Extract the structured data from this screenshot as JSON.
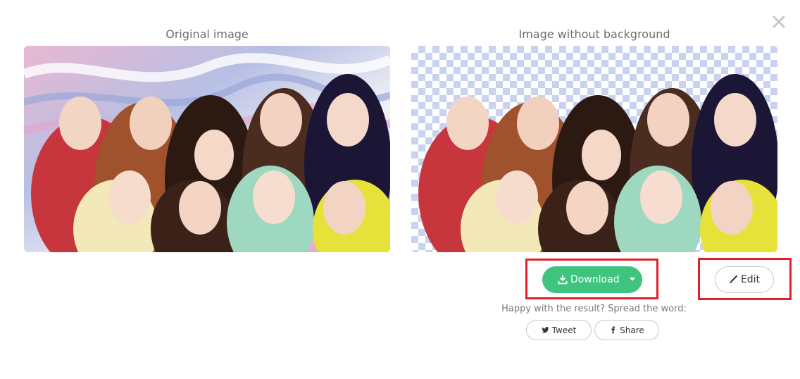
{
  "panels": {
    "original_title": "Original image",
    "result_title": "Image without background"
  },
  "actions": {
    "download_label": "Download",
    "edit_label": "Edit"
  },
  "share": {
    "prompt": "Happy with the result? Spread the word:",
    "tweet_label": "Tweet",
    "share_label": "Share"
  },
  "icons": {
    "close": "close-icon",
    "download": "download-icon",
    "dropdown": "caret-down-icon",
    "edit": "brush-icon",
    "twitter": "twitter-icon",
    "facebook": "facebook-icon"
  },
  "colors": {
    "download_button": "#3ec47f",
    "highlight_box": "#e21f2a",
    "checker": "#c9d3ef"
  }
}
